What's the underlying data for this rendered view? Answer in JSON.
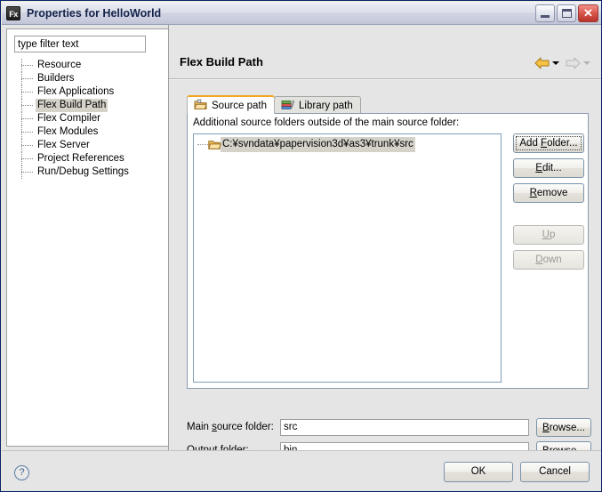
{
  "window": {
    "title": "Properties for HelloWorld",
    "app_icon": "Fx",
    "minimize_label": "Minimize",
    "maximize_label": "Maximize",
    "close_label": "Close",
    "close_glyph": "✕"
  },
  "sidebar": {
    "filter_value": "type filter text",
    "filter_placeholder": "type filter text",
    "items": [
      {
        "label": "Resource",
        "selected": false
      },
      {
        "label": "Builders",
        "selected": false
      },
      {
        "label": "Flex Applications",
        "selected": false
      },
      {
        "label": "Flex Build Path",
        "selected": true
      },
      {
        "label": "Flex Compiler",
        "selected": false
      },
      {
        "label": "Flex Modules",
        "selected": false
      },
      {
        "label": "Flex Server",
        "selected": false
      },
      {
        "label": "Project References",
        "selected": false
      },
      {
        "label": "Run/Debug Settings",
        "selected": false
      }
    ]
  },
  "page": {
    "title": "Flex Build Path",
    "nav": {
      "back_icon": "back-arrow-icon",
      "back_enabled": true,
      "forward_icon": "forward-arrow-icon",
      "forward_enabled": false
    },
    "tabs": [
      {
        "label": "Source path",
        "icon": "package-folder-icon",
        "active": true
      },
      {
        "label": "Library path",
        "icon": "books-icon",
        "active": false
      }
    ],
    "source_path": {
      "description": "Additional source folders outside of the main source folder:",
      "entries": [
        {
          "label": "C:¥svndata¥papervision3d¥as3¥trunk¥src",
          "icon": "open-folder-icon",
          "selected": true
        }
      ],
      "buttons": [
        {
          "label": "Add Folder...",
          "accel": "F",
          "enabled": true,
          "focused": true
        },
        {
          "label": "Edit...",
          "accel": "E",
          "enabled": true,
          "focused": false
        },
        {
          "label": "Remove",
          "accel": "R",
          "enabled": true,
          "focused": false
        },
        {
          "label": "Up",
          "accel": "U",
          "enabled": false,
          "focused": false
        },
        {
          "label": "Down",
          "accel": "D",
          "enabled": false,
          "focused": false
        }
      ]
    },
    "fields": [
      {
        "label": "Main source folder:",
        "accel": "s",
        "value": "src",
        "browse_label": "Browse...",
        "browse_accel": "B"
      },
      {
        "label": "Output folder:",
        "accel": "O",
        "value": "bin",
        "browse_label": "Browse...",
        "browse_accel": "B"
      }
    ]
  },
  "footer": {
    "help_icon": "question-mark-icon",
    "help_glyph": "?",
    "ok_label": "OK",
    "cancel_label": "Cancel"
  },
  "colors": {
    "accent_tab": "#f5a623",
    "title_text": "#14234b",
    "selection": "#d5d2ca",
    "dialog_bg": "#e5e5e5",
    "list_border": "#7f9db9"
  }
}
